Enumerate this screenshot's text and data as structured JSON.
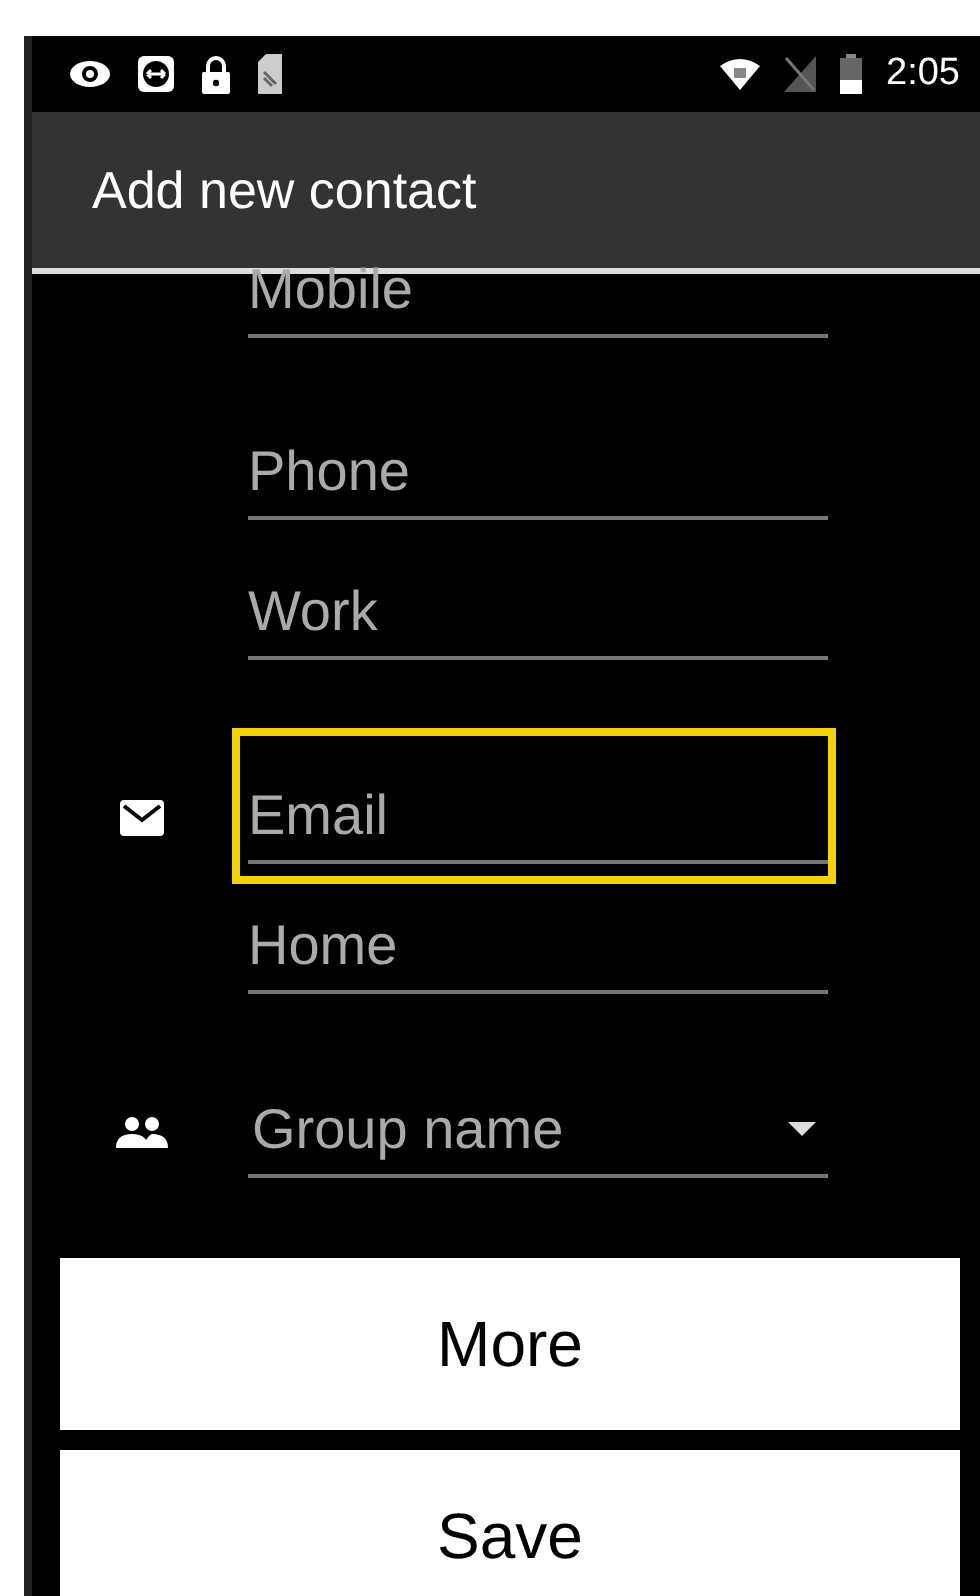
{
  "status_bar": {
    "time": "2:05"
  },
  "app_bar": {
    "title": "Add new contact"
  },
  "fields": [
    {
      "kind": "text",
      "placeholder": "Mobile",
      "highlighted": false
    },
    {
      "kind": "text",
      "placeholder": "Phone",
      "highlighted": false
    },
    {
      "kind": "text",
      "placeholder": "Work",
      "highlighted": false
    },
    {
      "kind": "email",
      "placeholder": "Email",
      "highlighted": true
    },
    {
      "kind": "text",
      "placeholder": "Home",
      "highlighted": false
    },
    {
      "kind": "group",
      "placeholder": "Group name",
      "highlighted": false
    }
  ],
  "buttons": [
    "More",
    "Save"
  ]
}
